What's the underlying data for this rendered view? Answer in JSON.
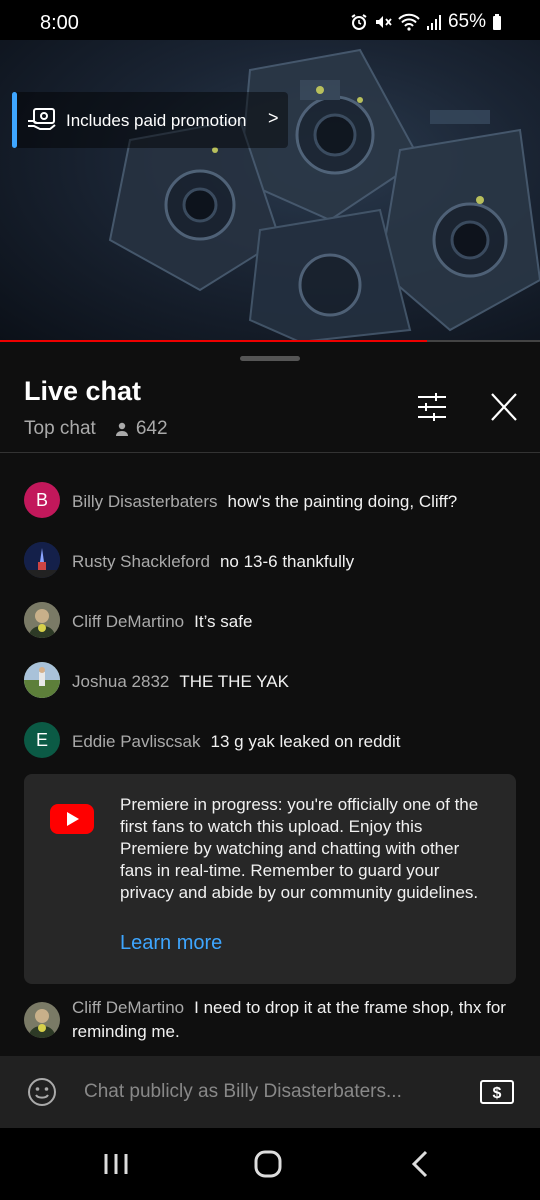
{
  "status_bar": {
    "time": "8:00",
    "battery": "65%"
  },
  "video": {
    "promo_label": "Includes paid promotion",
    "progress": 0.79
  },
  "chat": {
    "title": "Live chat",
    "mode": "Top chat",
    "viewers": "642",
    "messages": [
      {
        "avatar_letter": "B",
        "avatar_color": "#c2185b",
        "author": "Billy Disasterbaters",
        "text": "how's the painting doing, Cliff?"
      },
      {
        "avatar_letter": "",
        "avatar_color": "#1a2a5a",
        "author": "Rusty Shackleford",
        "text": "no 13-6 thankfully"
      },
      {
        "avatar_letter": "",
        "avatar_color": "#6b6b5a",
        "author": "Cliff DeMartino",
        "text": "It’s safe"
      },
      {
        "avatar_letter": "",
        "avatar_color": "#7a9a6a",
        "author": "Joshua 2832",
        "text": "THE THE YAK"
      },
      {
        "avatar_letter": "E",
        "avatar_color": "#0b5a45",
        "author": "Eddie Pavliscsak",
        "text": "13 g yak leaked on reddit"
      }
    ],
    "notice": {
      "text": "Premiere in progress: you're officially one of the first fans to watch this upload. Enjoy this Premiere by watching and chatting with other fans in real-time. Remember to guard your privacy and abide by our community guidelines.",
      "link": "Learn more"
    },
    "last_message": {
      "author": "Cliff DeMartino",
      "text": "I need to drop it at the frame shop, thx for reminding me."
    },
    "input_placeholder": "Chat publicly as Billy Disasterbaters..."
  },
  "colors": {
    "accent": "#3ea6ff",
    "progress": "#ee0000",
    "youtube_red": "#ff0000"
  }
}
